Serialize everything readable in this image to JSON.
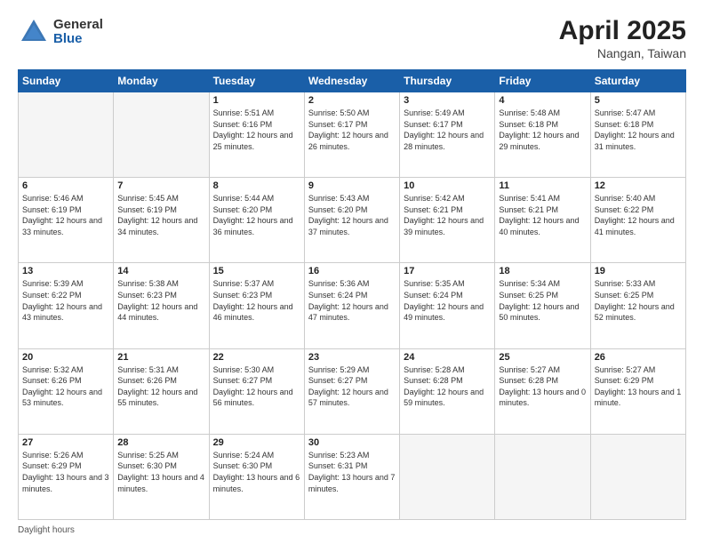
{
  "header": {
    "logo_general": "General",
    "logo_blue": "Blue",
    "title": "April 2025",
    "location": "Nangan, Taiwan"
  },
  "days_of_week": [
    "Sunday",
    "Monday",
    "Tuesday",
    "Wednesday",
    "Thursday",
    "Friday",
    "Saturday"
  ],
  "weeks": [
    [
      {
        "day": "",
        "info": ""
      },
      {
        "day": "",
        "info": ""
      },
      {
        "day": "1",
        "info": "Sunrise: 5:51 AM\nSunset: 6:16 PM\nDaylight: 12 hours and 25 minutes."
      },
      {
        "day": "2",
        "info": "Sunrise: 5:50 AM\nSunset: 6:17 PM\nDaylight: 12 hours and 26 minutes."
      },
      {
        "day": "3",
        "info": "Sunrise: 5:49 AM\nSunset: 6:17 PM\nDaylight: 12 hours and 28 minutes."
      },
      {
        "day": "4",
        "info": "Sunrise: 5:48 AM\nSunset: 6:18 PM\nDaylight: 12 hours and 29 minutes."
      },
      {
        "day": "5",
        "info": "Sunrise: 5:47 AM\nSunset: 6:18 PM\nDaylight: 12 hours and 31 minutes."
      }
    ],
    [
      {
        "day": "6",
        "info": "Sunrise: 5:46 AM\nSunset: 6:19 PM\nDaylight: 12 hours and 33 minutes."
      },
      {
        "day": "7",
        "info": "Sunrise: 5:45 AM\nSunset: 6:19 PM\nDaylight: 12 hours and 34 minutes."
      },
      {
        "day": "8",
        "info": "Sunrise: 5:44 AM\nSunset: 6:20 PM\nDaylight: 12 hours and 36 minutes."
      },
      {
        "day": "9",
        "info": "Sunrise: 5:43 AM\nSunset: 6:20 PM\nDaylight: 12 hours and 37 minutes."
      },
      {
        "day": "10",
        "info": "Sunrise: 5:42 AM\nSunset: 6:21 PM\nDaylight: 12 hours and 39 minutes."
      },
      {
        "day": "11",
        "info": "Sunrise: 5:41 AM\nSunset: 6:21 PM\nDaylight: 12 hours and 40 minutes."
      },
      {
        "day": "12",
        "info": "Sunrise: 5:40 AM\nSunset: 6:22 PM\nDaylight: 12 hours and 41 minutes."
      }
    ],
    [
      {
        "day": "13",
        "info": "Sunrise: 5:39 AM\nSunset: 6:22 PM\nDaylight: 12 hours and 43 minutes."
      },
      {
        "day": "14",
        "info": "Sunrise: 5:38 AM\nSunset: 6:23 PM\nDaylight: 12 hours and 44 minutes."
      },
      {
        "day": "15",
        "info": "Sunrise: 5:37 AM\nSunset: 6:23 PM\nDaylight: 12 hours and 46 minutes."
      },
      {
        "day": "16",
        "info": "Sunrise: 5:36 AM\nSunset: 6:24 PM\nDaylight: 12 hours and 47 minutes."
      },
      {
        "day": "17",
        "info": "Sunrise: 5:35 AM\nSunset: 6:24 PM\nDaylight: 12 hours and 49 minutes."
      },
      {
        "day": "18",
        "info": "Sunrise: 5:34 AM\nSunset: 6:25 PM\nDaylight: 12 hours and 50 minutes."
      },
      {
        "day": "19",
        "info": "Sunrise: 5:33 AM\nSunset: 6:25 PM\nDaylight: 12 hours and 52 minutes."
      }
    ],
    [
      {
        "day": "20",
        "info": "Sunrise: 5:32 AM\nSunset: 6:26 PM\nDaylight: 12 hours and 53 minutes."
      },
      {
        "day": "21",
        "info": "Sunrise: 5:31 AM\nSunset: 6:26 PM\nDaylight: 12 hours and 55 minutes."
      },
      {
        "day": "22",
        "info": "Sunrise: 5:30 AM\nSunset: 6:27 PM\nDaylight: 12 hours and 56 minutes."
      },
      {
        "day": "23",
        "info": "Sunrise: 5:29 AM\nSunset: 6:27 PM\nDaylight: 12 hours and 57 minutes."
      },
      {
        "day": "24",
        "info": "Sunrise: 5:28 AM\nSunset: 6:28 PM\nDaylight: 12 hours and 59 minutes."
      },
      {
        "day": "25",
        "info": "Sunrise: 5:27 AM\nSunset: 6:28 PM\nDaylight: 13 hours and 0 minutes."
      },
      {
        "day": "26",
        "info": "Sunrise: 5:27 AM\nSunset: 6:29 PM\nDaylight: 13 hours and 1 minute."
      }
    ],
    [
      {
        "day": "27",
        "info": "Sunrise: 5:26 AM\nSunset: 6:29 PM\nDaylight: 13 hours and 3 minutes."
      },
      {
        "day": "28",
        "info": "Sunrise: 5:25 AM\nSunset: 6:30 PM\nDaylight: 13 hours and 4 minutes."
      },
      {
        "day": "29",
        "info": "Sunrise: 5:24 AM\nSunset: 6:30 PM\nDaylight: 13 hours and 6 minutes."
      },
      {
        "day": "30",
        "info": "Sunrise: 5:23 AM\nSunset: 6:31 PM\nDaylight: 13 hours and 7 minutes."
      },
      {
        "day": "",
        "info": ""
      },
      {
        "day": "",
        "info": ""
      },
      {
        "day": "",
        "info": ""
      }
    ]
  ],
  "footer": {
    "daylight_label": "Daylight hours"
  }
}
